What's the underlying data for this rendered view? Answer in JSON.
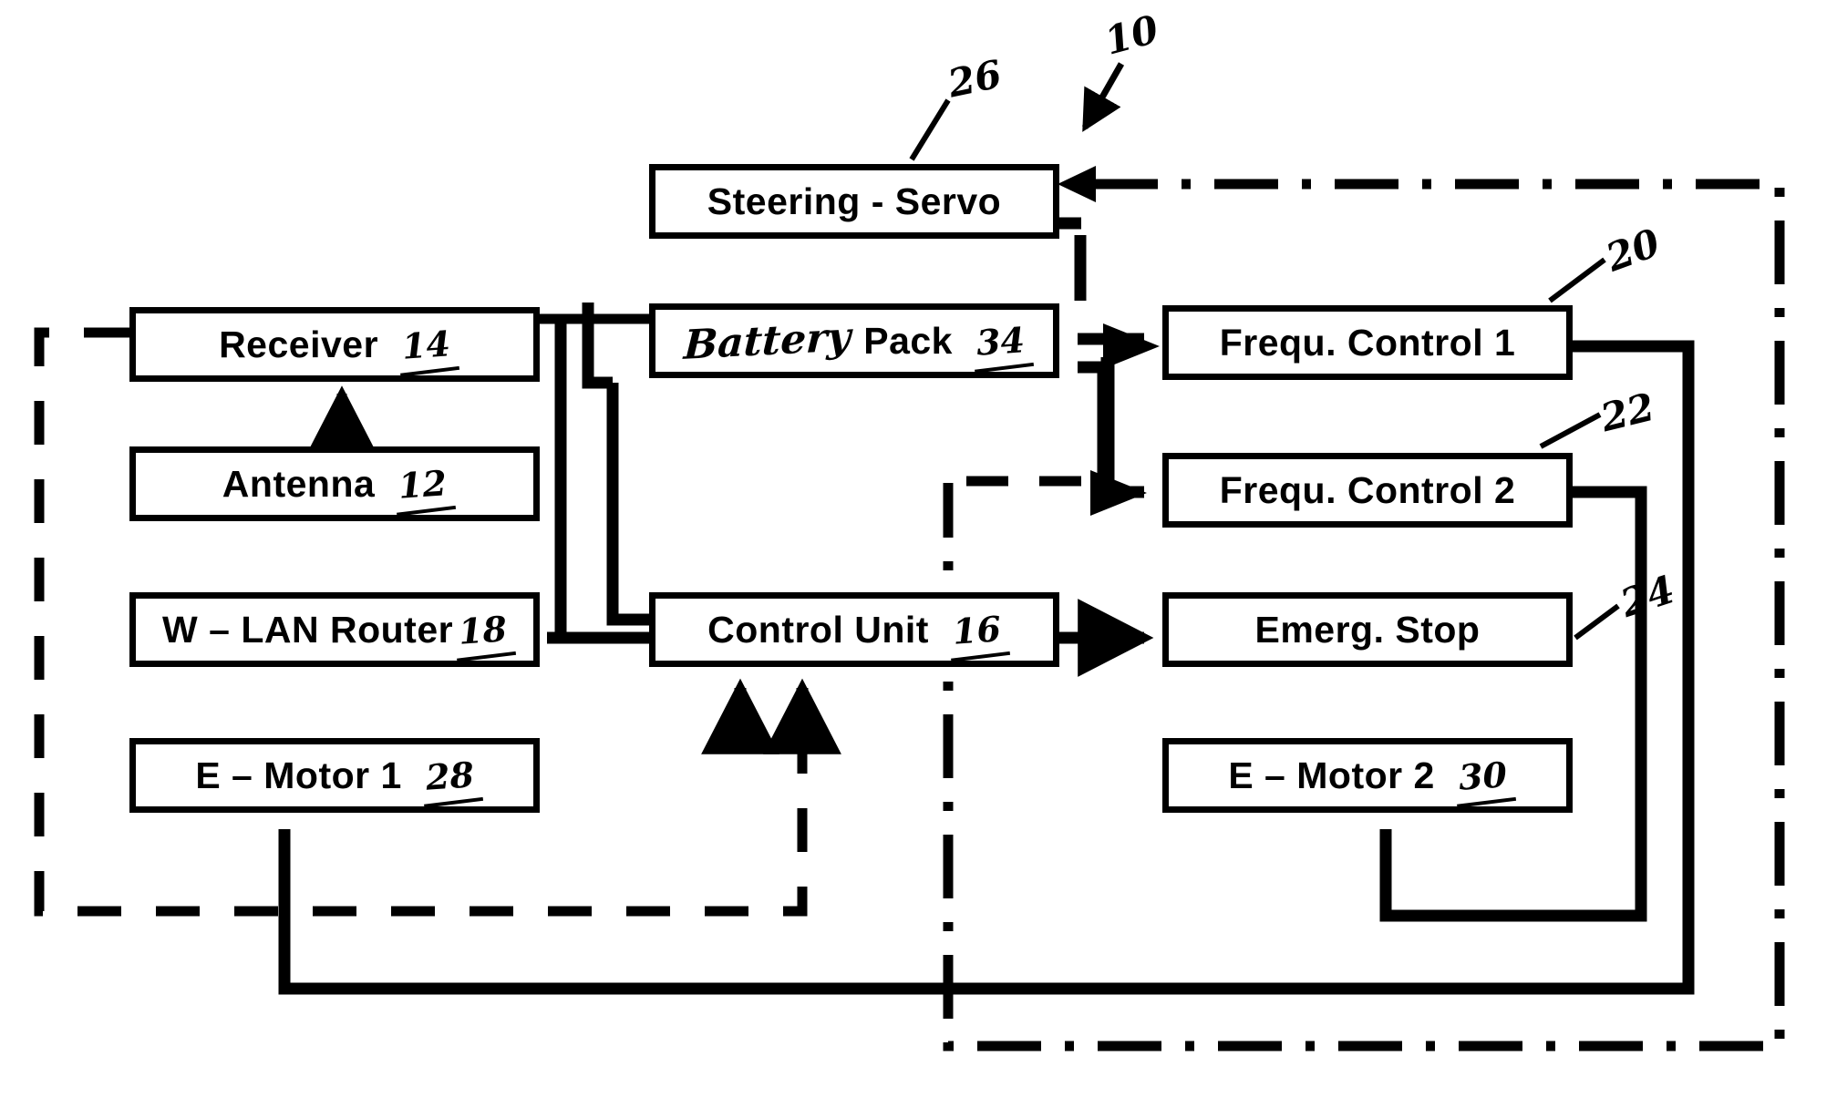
{
  "figure": {
    "kind": "patent-block-diagram",
    "overall_ref": "10",
    "line_color": "#000000",
    "background_color": "#ffffff"
  },
  "blocks": [
    {
      "id": "steering_servo",
      "label": "Steering - Servo",
      "ref": "26",
      "ref_position": "external"
    },
    {
      "id": "receiver",
      "label": "Receiver",
      "ref": "14",
      "ref_position": "inline"
    },
    {
      "id": "battery_pack",
      "label_script": "Battery",
      "label": "Pack",
      "ref": "34",
      "ref_position": "inline"
    },
    {
      "id": "frequ_control_1",
      "label": "Frequ. Control 1",
      "ref": "20",
      "ref_position": "external"
    },
    {
      "id": "antenna",
      "label": "Antenna",
      "ref": "12",
      "ref_position": "inline"
    },
    {
      "id": "frequ_control_2",
      "label": "Frequ. Control 2",
      "ref": "22",
      "ref_position": "external"
    },
    {
      "id": "wlan_router",
      "label": "W – LAN Router",
      "ref": "18",
      "ref_position": "inline"
    },
    {
      "id": "control_unit",
      "label": "Control Unit",
      "ref": "16",
      "ref_position": "inline"
    },
    {
      "id": "emerg_stop",
      "label": "Emerg. Stop",
      "ref": "24",
      "ref_position": "external"
    },
    {
      "id": "e_motor_1",
      "label": "E – Motor 1",
      "ref": "28",
      "ref_position": "inline"
    },
    {
      "id": "e_motor_2",
      "label": "E – Motor 2",
      "ref": "30",
      "ref_position": "inline"
    }
  ],
  "callouts": [
    {
      "id": "callout-10",
      "text": "10",
      "note": "overall assembly, arrow points down-left"
    },
    {
      "id": "callout-26",
      "text": "26",
      "note": "leader to Steering - Servo"
    },
    {
      "id": "callout-20",
      "text": "20",
      "note": "leader to Frequ. Control 1"
    },
    {
      "id": "callout-22",
      "text": "22",
      "note": "leader to Frequ. Control 2"
    },
    {
      "id": "callout-24",
      "text": "24",
      "note": "leader to Emerg. Stop"
    }
  ],
  "connections": [
    {
      "from": "antenna",
      "to": "receiver",
      "style": "solid",
      "arrow": true
    },
    {
      "from": "receiver",
      "to": "battery_pack",
      "style": "solid",
      "arrow": false
    },
    {
      "from": "battery_pack",
      "to": "steering_servo",
      "style": "solid",
      "arrow": false
    },
    {
      "from": "battery_pack",
      "to": "frequ_control_1",
      "style": "solid",
      "arrow": true
    },
    {
      "from": "battery_pack",
      "to": "frequ_control_2",
      "style": "solid",
      "arrow": true
    },
    {
      "from": "battery_pack",
      "to": "control_unit",
      "style": "solid",
      "arrow": false
    },
    {
      "from": "wlan_router",
      "to": "control_unit",
      "style": "solid",
      "arrow": false
    },
    {
      "from": "control_unit",
      "to": "emerg_stop",
      "style": "solid",
      "arrow": true
    },
    {
      "from": "frequ_control_1",
      "to": "e_motor_1",
      "style": "solid",
      "arrow": false
    },
    {
      "from": "frequ_control_2",
      "to": "e_motor_2",
      "style": "solid",
      "arrow": false
    },
    {
      "from": "dashed_bus",
      "to": "control_unit",
      "style": "dashed",
      "arrow": true
    },
    {
      "from": "dash_dot_bus",
      "to": "steering_servo",
      "style": "dash-dot",
      "arrow": true
    }
  ],
  "boundaries": [
    {
      "id": "dashed-boundary",
      "style": "dashed",
      "note": "encloses receiver / antenna / router / motor 1 group"
    },
    {
      "id": "dashdot-boundary",
      "style": "dash-dot",
      "note": "encloses right-hand control group, feeds steering servo"
    }
  ]
}
